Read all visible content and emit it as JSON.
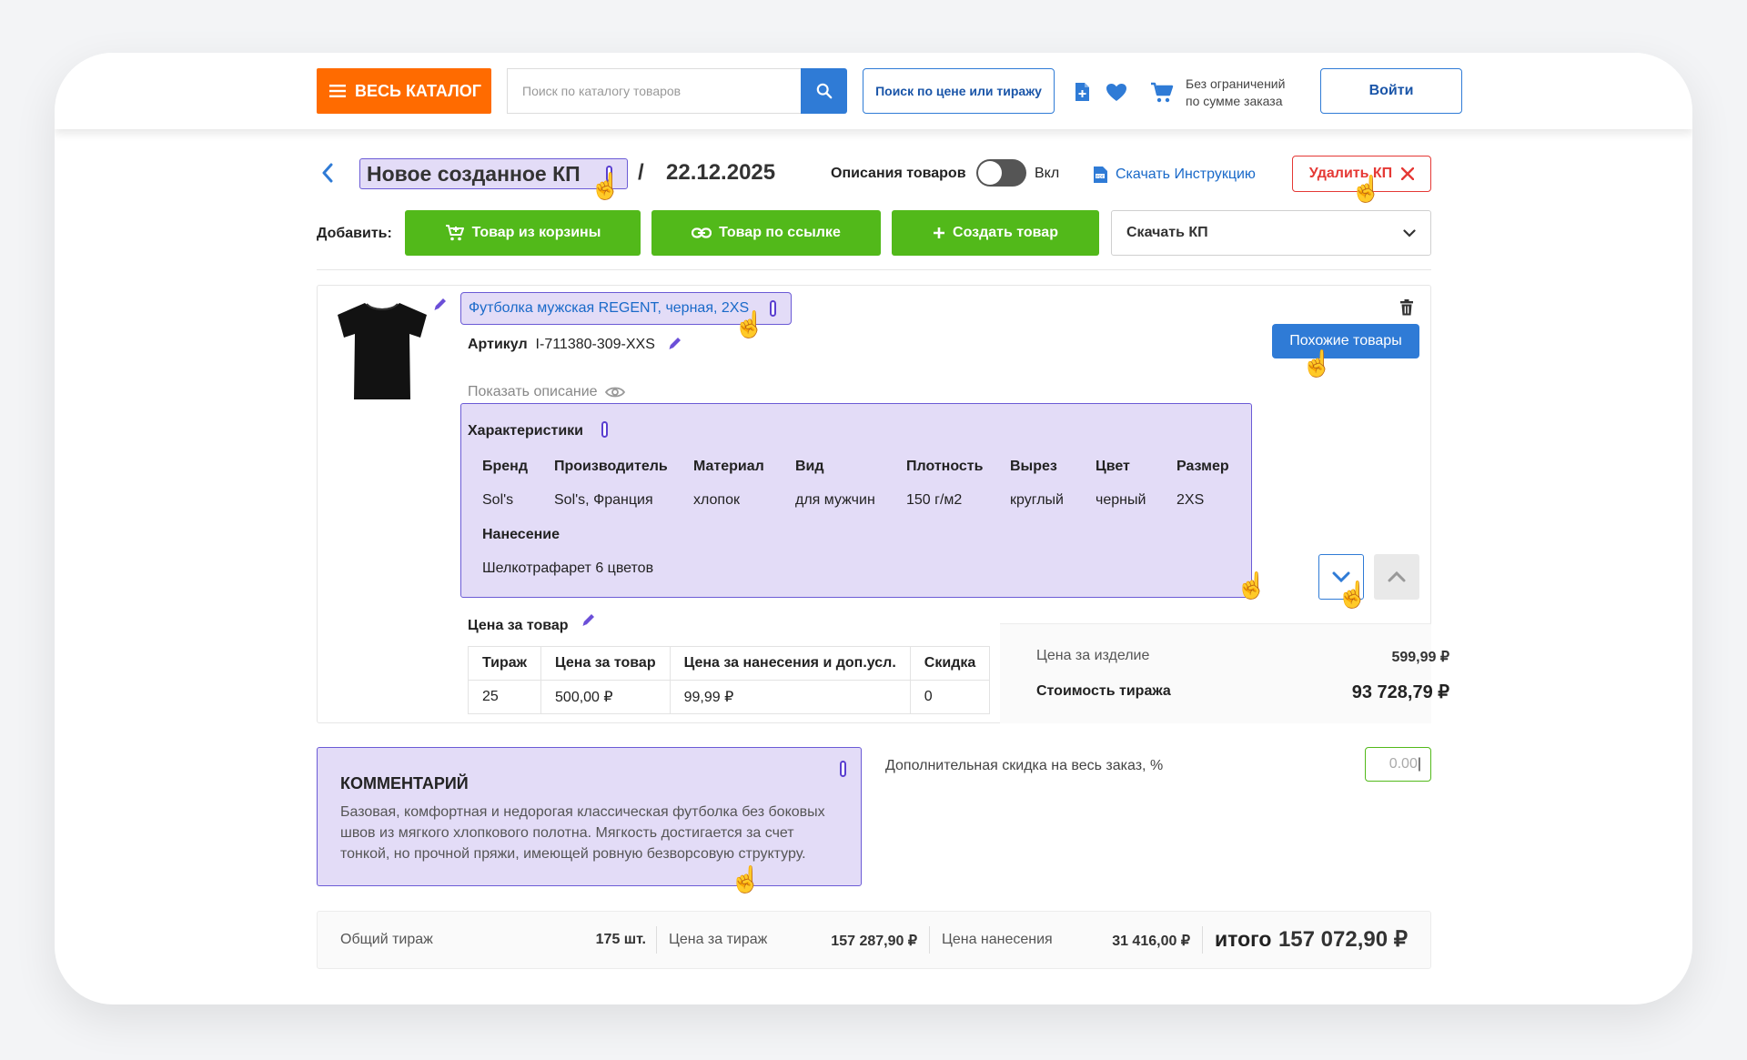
{
  "header": {
    "catalog_label": "ВЕСЬ КАТАЛОГ",
    "search_placeholder": "Поиск по каталогу товаров",
    "price_search_label": "Поиск по цене или тиражу",
    "order_limit_line1": "Без ограничений",
    "order_limit_line2": "по сумме заказа",
    "login_label": "Войти"
  },
  "toolbar": {
    "kp_name": "Новое созданное КП",
    "separator": "/",
    "date": "22.12.2025",
    "descriptions_label": "Описания товаров",
    "toggle_state": "Вкл",
    "download_instructions": "Скачать Инструкцию",
    "delete_label": "Удалить КП"
  },
  "add": {
    "label": "Добавить:",
    "from_cart": "Товар из корзины",
    "by_link": "Товар по ссылке",
    "create": "Создать товар",
    "download_kp": "Скачать КП"
  },
  "product": {
    "name": "Футболка мужская REGENT, черная, 2XS",
    "article_label": "Артикул",
    "article_value": "I-711380-309-XXS",
    "show_description": "Показать описание",
    "similar_button": "Похожие товары",
    "characteristics_title": "Характеристики",
    "characteristics": [
      {
        "key": "Бренд",
        "value": "Sol's"
      },
      {
        "key": "Производитель",
        "value": "Sol's, Франция"
      },
      {
        "key": "Материал",
        "value": "хлопок"
      },
      {
        "key": "Вид",
        "value": "для мужчин"
      },
      {
        "key": "Плотность",
        "value": "150 г/м2"
      },
      {
        "key": "Вырез",
        "value": "круглый"
      },
      {
        "key": "Цвет",
        "value": "черный"
      },
      {
        "key": "Размер",
        "value": "2XS"
      },
      {
        "key": "Нанесение",
        "value": "Шелкотрафарет 6 цветов"
      }
    ],
    "price_title": "Цена за товар",
    "price_table": {
      "headers": [
        "Тираж",
        "Цена за товар",
        "Цена за нанесения и доп.усл.",
        "Скидка"
      ],
      "row": [
        "25",
        "500,00 ₽",
        "99,99 ₽",
        "0"
      ]
    },
    "unit_price_label": "Цена за изделие",
    "unit_price_value": "599,99 ₽",
    "run_cost_label": "Стоимость тиража",
    "run_cost_value": "93 728,79 ₽"
  },
  "comment": {
    "title": "КОММЕНТАРИЙ",
    "text": "Базовая, комфортная и недорогая классическая футболка без боковых швов из мягкого хлопкового полотна. Мягкость достигается за счет тонкой, но прочной пряжи, имеющей ровную безворсовую структуру."
  },
  "discount": {
    "label": "Дополнительная скидка на весь заказ, %",
    "value": "0.00"
  },
  "totals": {
    "run_label": "Общий тираж",
    "run_value": "175 шт.",
    "price_label": "Цена за  тираж",
    "price_value": "157 287,90 ₽",
    "print_label": "Цена нанесения",
    "print_value": "31 416,00 ₽",
    "total_label": "итого",
    "total_value": "157 072,90 ₽"
  },
  "colors": {
    "accent_orange": "#ff6b00",
    "primary_blue": "#2f7bd6",
    "green": "#52b91a",
    "danger_red": "#e53935",
    "highlight_lilac": "#e3dcf7",
    "highlight_border": "#6b5bd6"
  },
  "icons": [
    "menu-icon",
    "search-icon",
    "document-add-icon",
    "heart-icon",
    "cart-icon",
    "chevron-left-icon",
    "pin-icon",
    "pdf-icon",
    "close-icon",
    "cart-add-icon",
    "link-icon",
    "plus-icon",
    "chevron-down-icon",
    "chevron-up-icon",
    "pencil-icon",
    "eye-icon",
    "trash-icon",
    "hand-cursor-icon"
  ]
}
